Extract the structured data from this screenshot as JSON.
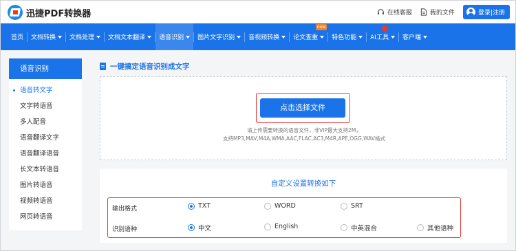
{
  "app": {
    "logo_text": "迅捷PDF转换器"
  },
  "top_links": {
    "service": "在线客服",
    "my_files": "我的文件",
    "login": "登录|注册"
  },
  "nav": {
    "items": [
      {
        "label": "首页",
        "caret": false
      },
      {
        "label": "文档转换",
        "caret": true
      },
      {
        "label": "文档处理",
        "caret": true
      },
      {
        "label": "文档文本翻译",
        "caret": true
      },
      {
        "label": "语音识别",
        "caret": true,
        "active": true
      },
      {
        "label": "图片文字识别",
        "caret": true
      },
      {
        "label": "音视频转换",
        "caret": true
      },
      {
        "label": "论文查重",
        "caret": true,
        "badge": "new"
      },
      {
        "label": "特色功能",
        "caret": true
      },
      {
        "label": "AI工具",
        "caret": true,
        "alert": true
      },
      {
        "label": "客户端",
        "caret": true
      }
    ]
  },
  "sidebar": {
    "title": "语音识别",
    "items": [
      {
        "label": "语音转文字",
        "active": true
      },
      {
        "label": "文字转语音"
      },
      {
        "label": "多人配音"
      },
      {
        "label": "语音翻译文字"
      },
      {
        "label": "语音翻译语音"
      },
      {
        "label": "长文本转语音"
      },
      {
        "label": "图片转语音"
      },
      {
        "label": "视频转语音"
      },
      {
        "label": "网页转语音"
      }
    ]
  },
  "main": {
    "title": "一键搞定语音识别成文字",
    "upload": {
      "button": "点击选择文件",
      "hint_line1": "请上传需要转换的语音文件，非VIP最大支持2M，",
      "hint_line2": "支持MP3,MAV,M4A,WMA,AAC,FLAC,AC3,M4R,APE,OGG,WAV格式"
    },
    "settings": {
      "title": "自定义设置转换如下",
      "output_label": "输出格式",
      "output_options": [
        "TXT",
        "WORD",
        "SRT"
      ],
      "output_selected": "TXT",
      "lang_label": "识别语种",
      "lang_options": [
        "中文",
        "English",
        "中英混合",
        "其他语种"
      ],
      "lang_selected": "中文"
    }
  },
  "colors": {
    "primary": "#1a73e8",
    "highlight": "#e6393a",
    "badge": "#f0822d"
  }
}
